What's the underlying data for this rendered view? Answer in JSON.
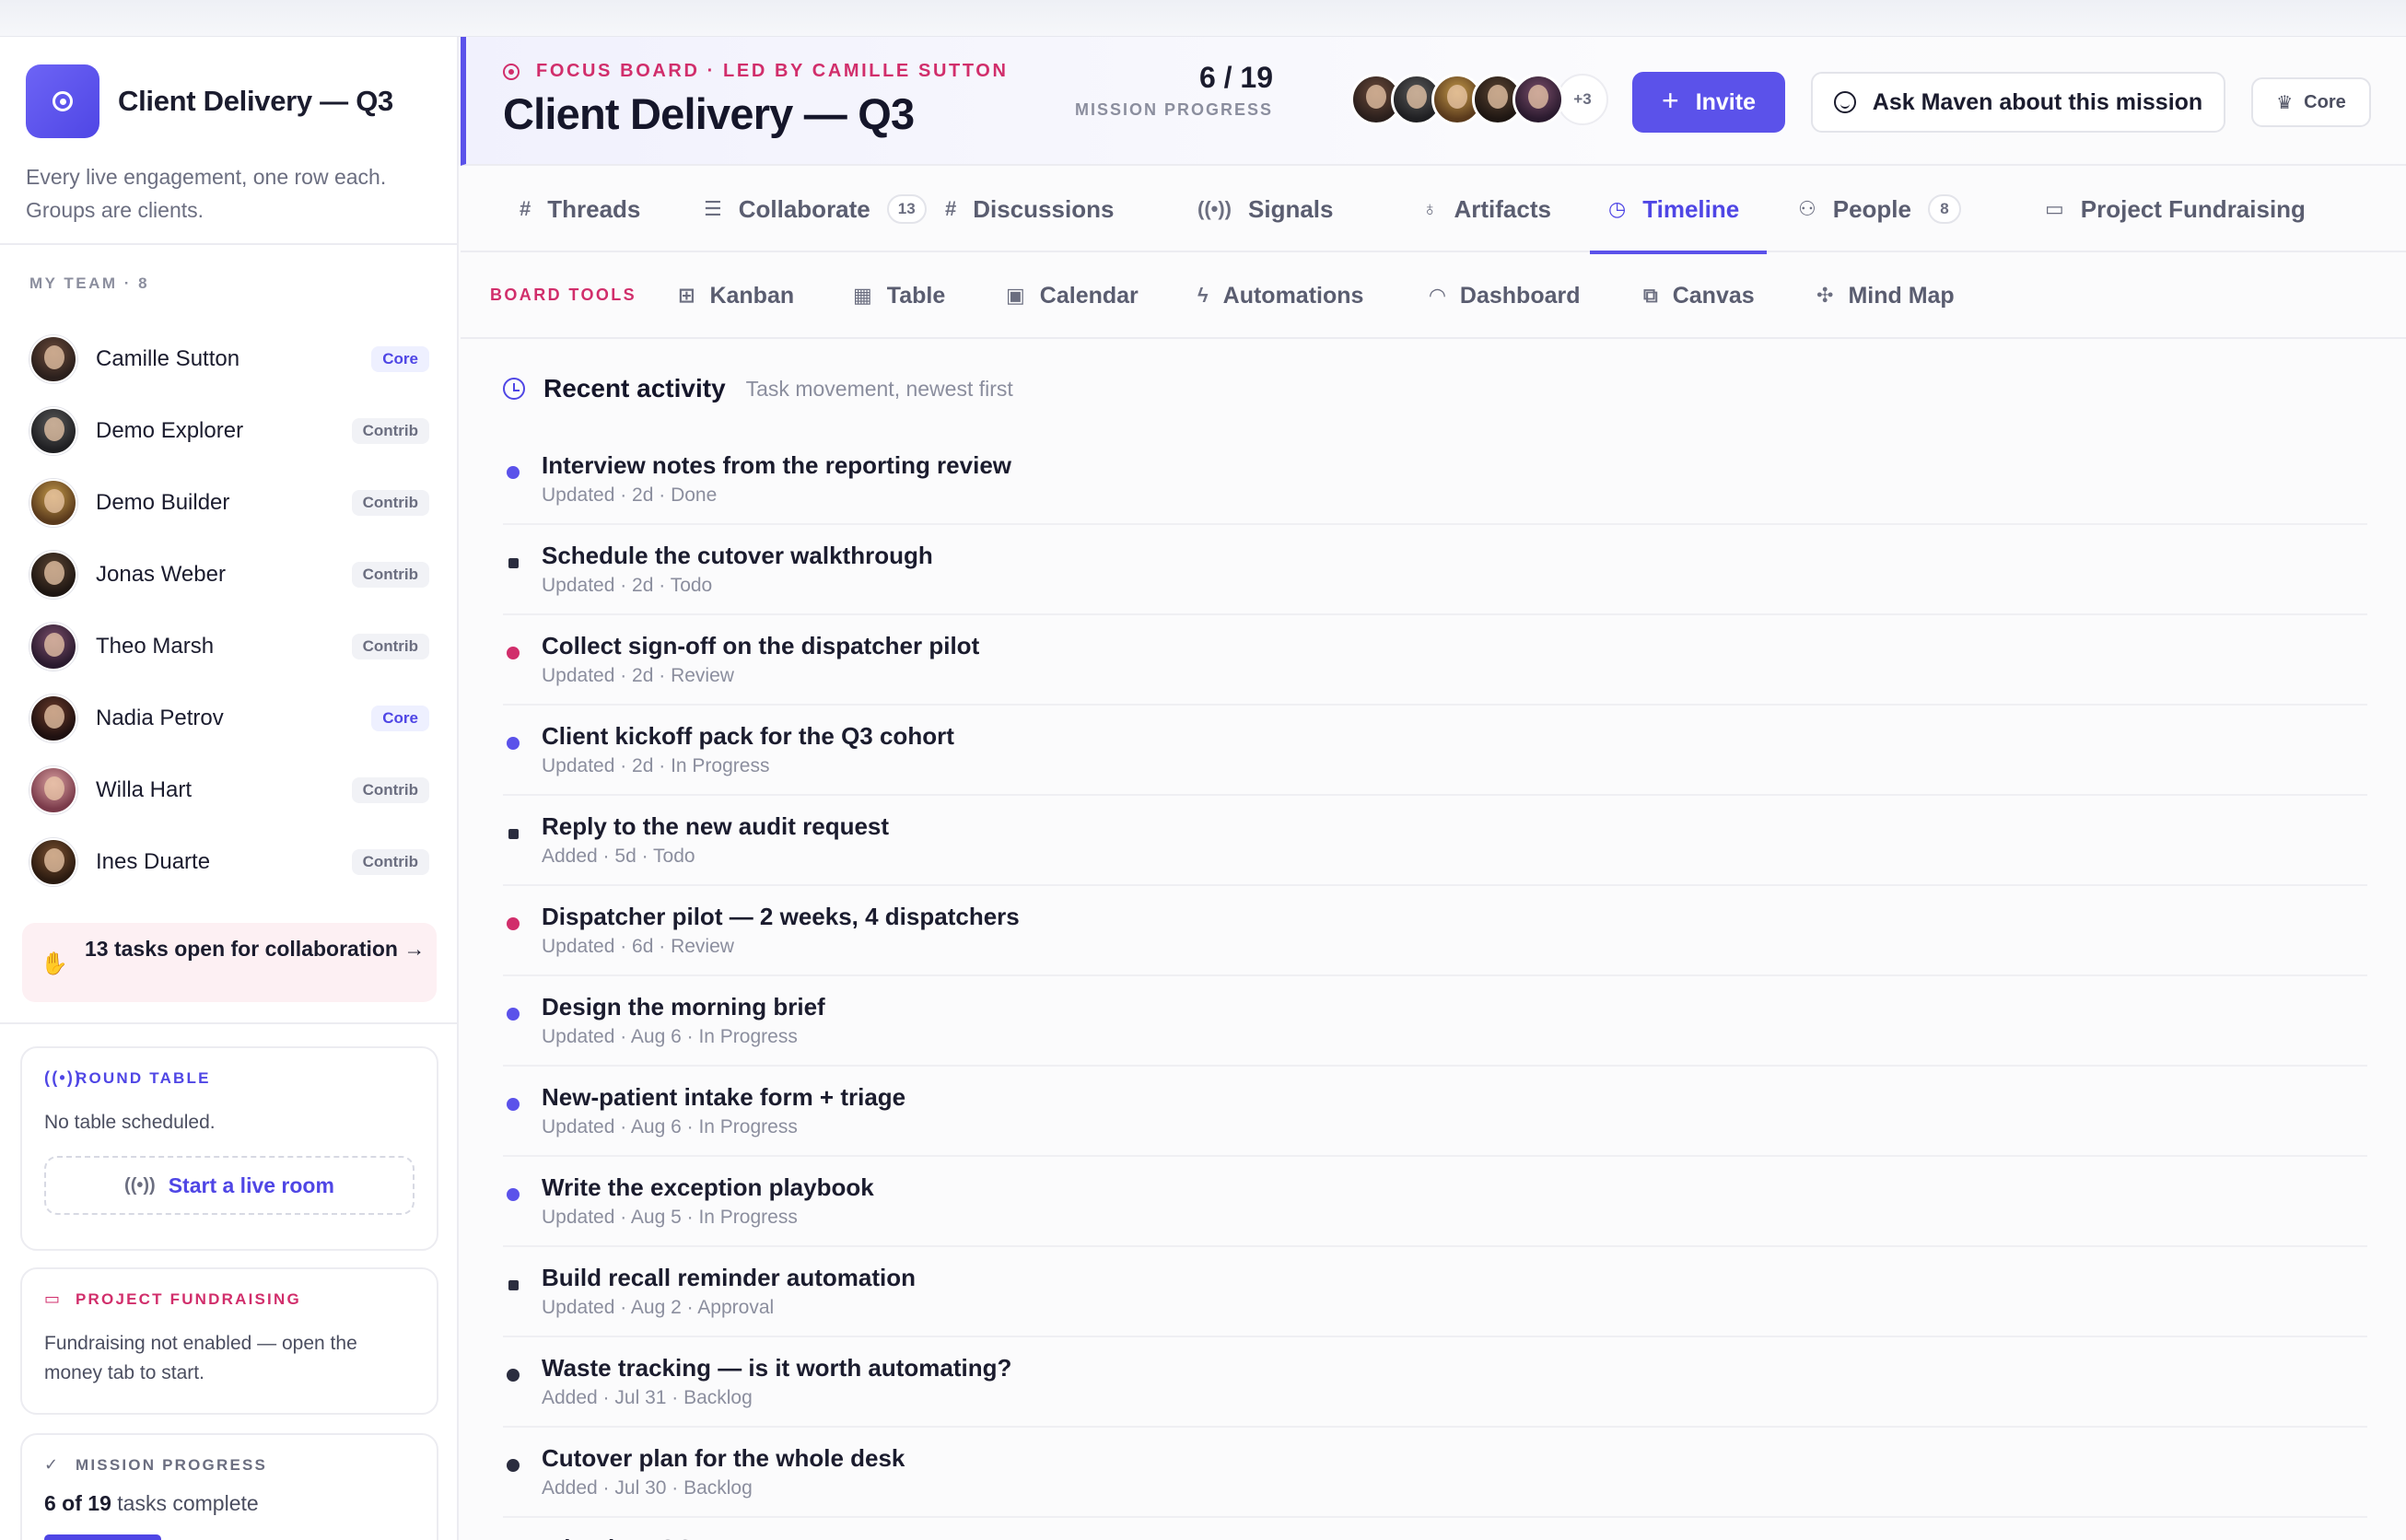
{
  "colors": {
    "accent": "#5b52ea",
    "pink": "#d12e6b",
    "status_done": "#5b52ea",
    "status_todo": "#2b2d3f",
    "status_review": "#d12e6b",
    "status_in_progress": "#5b52ea"
  },
  "sidebar": {
    "brand_title": "Client Delivery — Q3",
    "brand_icon": "target-icon",
    "brand_desc": "Every live engagement, one row each. Groups are clients.",
    "team_heading": "MY TEAM · 8",
    "members": [
      {
        "name": "Camille Sutton",
        "role": "Core"
      },
      {
        "name": "Demo Explorer",
        "role": "Contrib"
      },
      {
        "name": "Demo Builder",
        "role": "Contrib"
      },
      {
        "name": "Jonas Weber",
        "role": "Contrib"
      },
      {
        "name": "Theo Marsh",
        "role": "Contrib"
      },
      {
        "name": "Nadia Petrov",
        "role": "Core"
      },
      {
        "name": "Willa Hart",
        "role": "Contrib"
      },
      {
        "name": "Ines Duarte",
        "role": "Contrib"
      }
    ],
    "collab_text": "13 tasks open for collaboration →",
    "round_table": {
      "heading": "ROUND TABLE",
      "body": "No table scheduled.",
      "button": "Start a live room"
    },
    "fundraising": {
      "heading": "PROJECT FUNDRAISING",
      "body": "Fundraising not enabled — open the money tab to start."
    },
    "progress": {
      "heading": "MISSION PROGRESS",
      "bold": "6 of 19",
      "rest": " tasks complete",
      "fraction": 0.316
    }
  },
  "header": {
    "eyebrow": "FOCUS BOARD · LED BY CAMILLE SUTTON",
    "title": "Client Delivery — Q3",
    "progress_count": "6 / 19",
    "progress_label": "MISSION PROGRESS",
    "more_members": "+3",
    "invite": "Invite",
    "ask": "Ask Maven about this mission",
    "plan": "Core"
  },
  "tabs": [
    {
      "label": "Threads",
      "icon": "hash-icon"
    },
    {
      "label": "Collaborate",
      "icon": "list-icon",
      "count": "13"
    },
    {
      "label": "Discussions",
      "icon": "hash-icon"
    },
    {
      "label": "Signals",
      "icon": "broadcast-icon"
    },
    {
      "label": "Artifacts",
      "icon": "award-icon"
    },
    {
      "label": "Timeline",
      "icon": "clock-icon",
      "active": true
    },
    {
      "label": "People",
      "icon": "users-icon",
      "count": "8"
    },
    {
      "label": "Project Fundraising",
      "icon": "money-icon"
    }
  ],
  "board_tools": {
    "label": "BOARD TOOLS",
    "items": [
      {
        "label": "Kanban",
        "icon": "kanban-icon"
      },
      {
        "label": "Table",
        "icon": "table-icon"
      },
      {
        "label": "Calendar",
        "icon": "calendar-icon"
      },
      {
        "label": "Automations",
        "icon": "bolt-icon"
      },
      {
        "label": "Dashboard",
        "icon": "gauge-icon"
      },
      {
        "label": "Canvas",
        "icon": "canvas-icon"
      },
      {
        "label": "Mind Map",
        "icon": "mindmap-icon"
      }
    ]
  },
  "activity": {
    "title": "Recent activity",
    "subtitle": "Task movement, newest first",
    "items": [
      {
        "title": "Interview notes from the reporting review",
        "meta": "Updated · 2d · Done",
        "status": "done"
      },
      {
        "title": "Schedule the cutover walkthrough",
        "meta": "Updated · 2d · Todo",
        "status": "todo"
      },
      {
        "title": "Collect sign-off on the dispatcher pilot",
        "meta": "Updated · 2d · Review",
        "status": "review"
      },
      {
        "title": "Client kickoff pack for the Q3 cohort",
        "meta": "Updated · 2d · In Progress",
        "status": "progress"
      },
      {
        "title": "Reply to the new audit request",
        "meta": "Added · 5d · Todo",
        "status": "todo"
      },
      {
        "title": "Dispatcher pilot — 2 weeks, 4 dispatchers",
        "meta": "Updated · 6d · Review",
        "status": "review"
      },
      {
        "title": "Design the morning brief",
        "meta": "Updated · Aug 6 · In Progress",
        "status": "progress"
      },
      {
        "title": "New-patient intake form + triage",
        "meta": "Updated · Aug 6 · In Progress",
        "status": "progress"
      },
      {
        "title": "Write the exception playbook",
        "meta": "Updated · Aug 5 · In Progress",
        "status": "progress"
      },
      {
        "title": "Build recall reminder automation",
        "meta": "Updated · Aug 2 · Approval",
        "status": "todo"
      },
      {
        "title": "Waste tracking — is it worth automating?",
        "meta": "Added · Jul 31 · Backlog",
        "status": "backlog"
      },
      {
        "title": "Cutover plan for the whole desk",
        "meta": "Added · Jul 30 · Backlog",
        "status": "backlog"
      },
      {
        "title": "Wire the POS export",
        "meta": "",
        "status": "backlog"
      }
    ]
  }
}
